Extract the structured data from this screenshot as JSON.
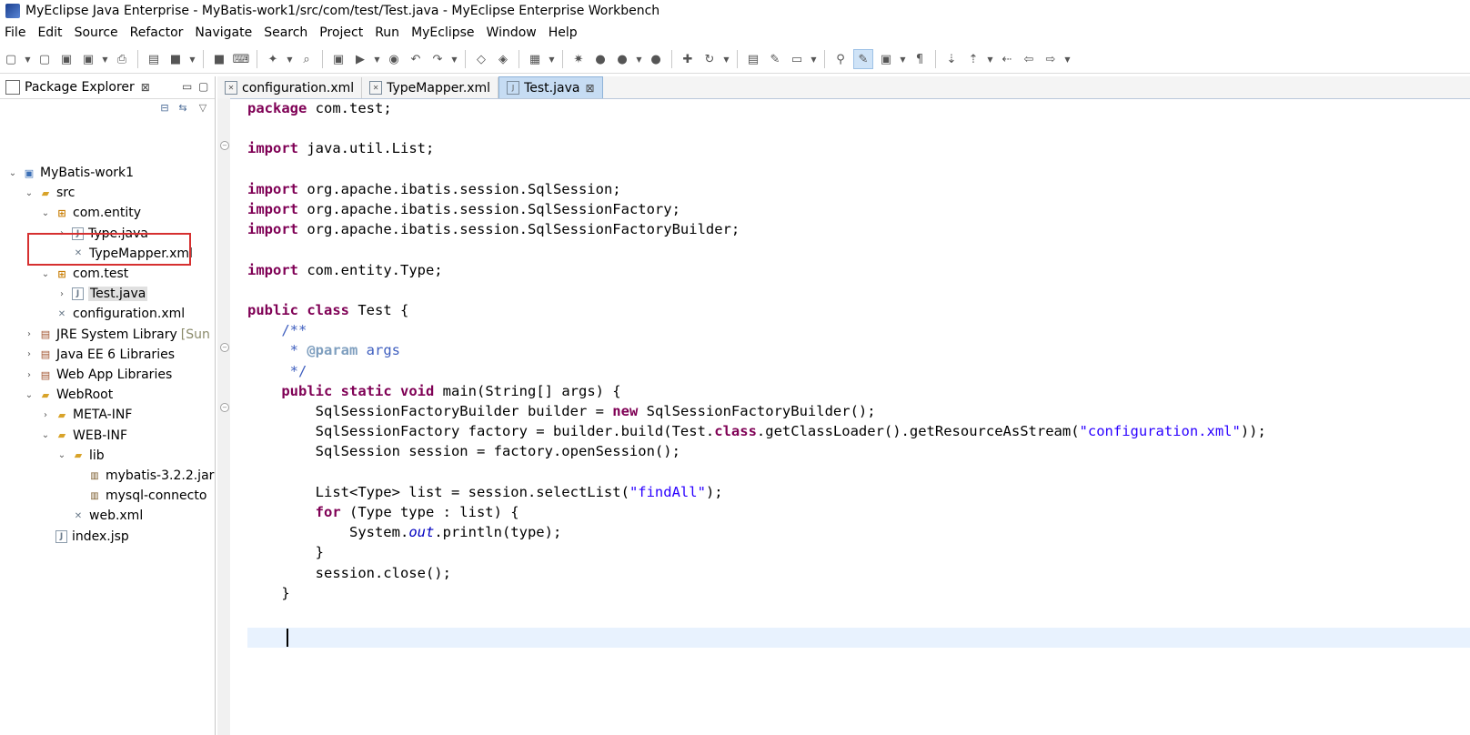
{
  "window": {
    "title": "MyEclipse Java Enterprise - MyBatis-work1/src/com/test/Test.java - MyEclipse Enterprise Workbench"
  },
  "menu": [
    "File",
    "Edit",
    "Source",
    "Refactor",
    "Navigate",
    "Search",
    "Project",
    "Run",
    "MyEclipse",
    "Window",
    "Help"
  ],
  "explorer": {
    "title": "Package Explorer",
    "tree": [
      {
        "label": "MyBatis-work1",
        "icon": "project-icon",
        "twisty": "expanded"
      },
      {
        "label": "src",
        "icon": "source-folder-icon",
        "twisty": "expanded"
      },
      {
        "label": "com.entity",
        "icon": "package-icon",
        "twisty": "expanded"
      },
      {
        "label": "Type.java",
        "icon": "java-file-icon",
        "twisty": "collapsed"
      },
      {
        "label": "TypeMapper.xml",
        "icon": "xml-file-icon",
        "twisty": ""
      },
      {
        "label": "com.test",
        "icon": "package-icon",
        "twisty": "expanded"
      },
      {
        "label": "Test.java",
        "icon": "java-file-icon",
        "twisty": "collapsed"
      },
      {
        "label": "configuration.xml",
        "icon": "xml-file-icon",
        "twisty": ""
      },
      {
        "label": "JRE System Library",
        "extra": "[Sun",
        "icon": "library-icon",
        "twisty": "collapsed"
      },
      {
        "label": "Java EE 6 Libraries",
        "icon": "library-icon",
        "twisty": "collapsed"
      },
      {
        "label": "Web App Libraries",
        "icon": "library-icon",
        "twisty": "collapsed"
      },
      {
        "label": "WebRoot",
        "icon": "folder-icon",
        "twisty": "expanded"
      },
      {
        "label": "META-INF",
        "icon": "folder-icon",
        "twisty": "collapsed"
      },
      {
        "label": "WEB-INF",
        "icon": "folder-icon",
        "twisty": "expanded"
      },
      {
        "label": "lib",
        "icon": "folder-icon",
        "twisty": "expanded"
      },
      {
        "label": "mybatis-3.2.2.jar",
        "icon": "jar-icon",
        "twisty": ""
      },
      {
        "label": "mysql-connecto",
        "icon": "jar-icon",
        "twisty": ""
      },
      {
        "label": "web.xml",
        "icon": "xml-file-icon",
        "twisty": ""
      },
      {
        "label": "index.jsp",
        "icon": "jsp-file-icon",
        "twisty": ""
      }
    ]
  },
  "editor": {
    "tabs": [
      {
        "label": "configuration.xml",
        "active": false
      },
      {
        "label": "TypeMapper.xml",
        "active": false
      },
      {
        "label": "Test.java",
        "active": true
      }
    ],
    "code": [
      [
        [
          "kw",
          "package"
        ],
        [
          "t",
          " com.test;"
        ]
      ],
      [],
      [
        [
          "kw",
          "import"
        ],
        [
          "t",
          " java.util.List;"
        ]
      ],
      [],
      [
        [
          "kw",
          "import"
        ],
        [
          "t",
          " org.apache.ibatis.session.SqlSession;"
        ]
      ],
      [
        [
          "kw",
          "import"
        ],
        [
          "t",
          " org.apache.ibatis.session.SqlSessionFactory;"
        ]
      ],
      [
        [
          "kw",
          "import"
        ],
        [
          "t",
          " org.apache.ibatis.session.SqlSessionFactoryBuilder;"
        ]
      ],
      [],
      [
        [
          "kw",
          "import"
        ],
        [
          "t",
          " com.entity.Type;"
        ]
      ],
      [],
      [
        [
          "kw",
          "public"
        ],
        [
          "t",
          " "
        ],
        [
          "kw",
          "class"
        ],
        [
          "t",
          " Test {"
        ]
      ],
      [
        [
          "t",
          "    "
        ],
        [
          "cmt",
          "/**"
        ]
      ],
      [
        [
          "t",
          "     "
        ],
        [
          "cmt",
          "* "
        ],
        [
          "tag",
          "@param"
        ],
        [
          "cmt",
          " args"
        ]
      ],
      [
        [
          "t",
          "     "
        ],
        [
          "cmt",
          "*/"
        ]
      ],
      [
        [
          "t",
          "    "
        ],
        [
          "kw",
          "public"
        ],
        [
          "t",
          " "
        ],
        [
          "kw",
          "static"
        ],
        [
          "t",
          " "
        ],
        [
          "kw",
          "void"
        ],
        [
          "t",
          " main(String[] args) {"
        ]
      ],
      [
        [
          "t",
          "        SqlSessionFactoryBuilder builder = "
        ],
        [
          "kw",
          "new"
        ],
        [
          "t",
          " SqlSessionFactoryBuilder();"
        ]
      ],
      [
        [
          "t",
          "        SqlSessionFactory factory = builder.build(Test."
        ],
        [
          "kw",
          "class"
        ],
        [
          "t",
          ".getClassLoader().getResourceAsStream("
        ],
        [
          "str",
          "\"configuration.xml\""
        ],
        [
          "t",
          "));"
        ]
      ],
      [
        [
          "t",
          "        SqlSession session = factory.openSession();"
        ]
      ],
      [],
      [
        [
          "t",
          "        List<Type> list = session.selectList("
        ],
        [
          "str",
          "\"findAll\""
        ],
        [
          "t",
          ");"
        ]
      ],
      [
        [
          "t",
          "        "
        ],
        [
          "kw",
          "for"
        ],
        [
          "t",
          " (Type type : list) {"
        ]
      ],
      [
        [
          "t",
          "            System."
        ],
        [
          "fld",
          "out"
        ],
        [
          "t",
          ".println(type);"
        ]
      ],
      [
        [
          "t",
          "        }"
        ]
      ],
      [
        [
          "t",
          "        session.close();"
        ]
      ],
      [
        [
          "t",
          "    }"
        ]
      ],
      []
    ]
  },
  "toolbar_icons": [
    "new-icon",
    "new-dropdown-icon",
    "save-icon",
    "save-all-icon",
    "print-icon",
    "new-wizard-icon",
    "open-type-icon",
    "open-type-hierarchy-icon",
    "keyboard-icon",
    "new-java-project-icon",
    "search-icon",
    "deploy-icon",
    "run-server-icon",
    "open-browser-icon",
    "back-icon",
    "forward-icon",
    "task-icon",
    "servers-icon",
    "screenshot-icon",
    "debug-icon",
    "run-icon",
    "run-config-icon",
    "external-tools-icon",
    "new-package-icon",
    "refresh-icon",
    "open-folder-icon",
    "brush-icon",
    "folder-open-icon",
    "toggle-icon",
    "mark-occurrences-icon",
    "block-selection-icon",
    "show-whitespace-icon",
    "next-annotation-icon",
    "prev-annotation-icon",
    "last-edit-icon",
    "back-nav-icon",
    "forward-nav-icon"
  ]
}
